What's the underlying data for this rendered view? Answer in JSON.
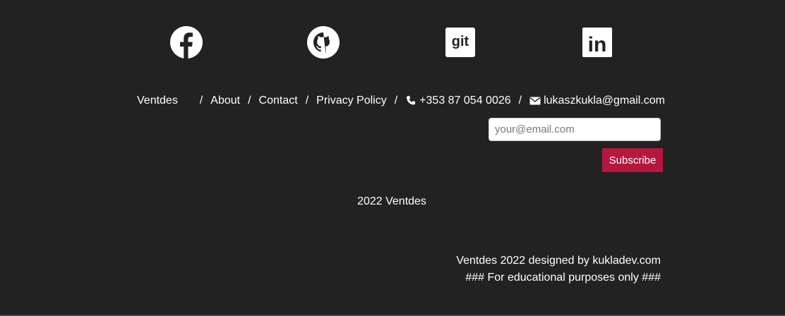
{
  "social": {
    "items": [
      {
        "icon": "facebook-icon"
      },
      {
        "icon": "github-icon"
      },
      {
        "icon": "git-icon",
        "text": "git"
      },
      {
        "icon": "linkedin-icon",
        "text": "in"
      }
    ]
  },
  "nav": {
    "brand": "Ventdes",
    "separator": "/",
    "about": "About",
    "contact": "Contact",
    "privacy": "Privacy Policy",
    "phone": "+353 87 054 0026",
    "email": "lukaszkukla@gmail.com"
  },
  "newsletter": {
    "placeholder": "your@email.com",
    "button_label": "Subscribe"
  },
  "copyright": "2022 Ventdes",
  "credits": {
    "line1": "Ventdes 2022 designed by kukladev.com",
    "line2": "### For educational purposes only ###"
  },
  "colors": {
    "background": "#222222",
    "accent": "#b5173f",
    "text": "#ffffff"
  }
}
